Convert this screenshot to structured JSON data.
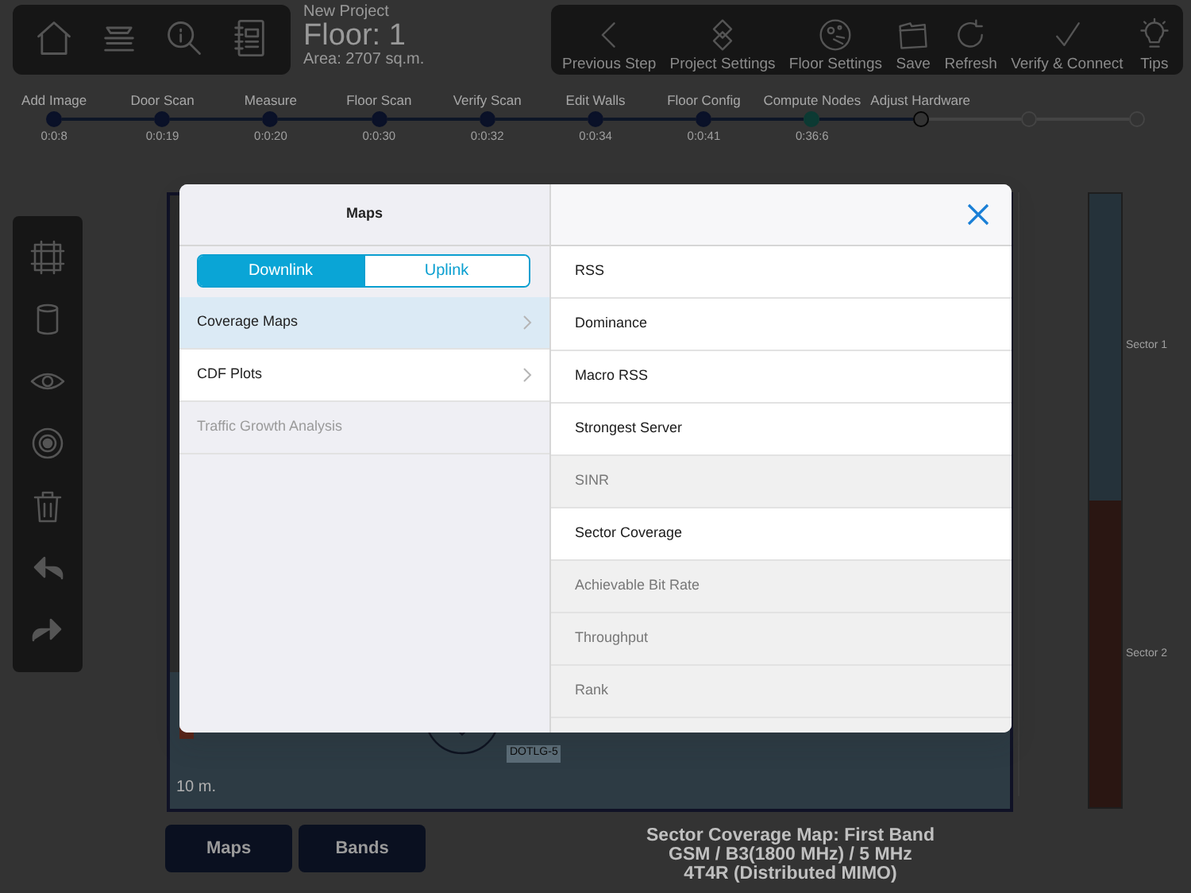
{
  "project": {
    "name": "New Project",
    "floor": "Floor: 1",
    "area": "Area: 2707 sq.m."
  },
  "toolbar": [
    {
      "label": "Previous Step"
    },
    {
      "label": "Project Settings"
    },
    {
      "label": "Floor Settings"
    },
    {
      "label": "Save"
    },
    {
      "label": "Refresh"
    },
    {
      "label": "Verify & Connect"
    },
    {
      "label": "Tips"
    }
  ],
  "steps": [
    {
      "label": "Add Image",
      "time": "0:0:8",
      "completed": true,
      "selected": false,
      "color": "#0a1128"
    },
    {
      "label": "Door Scan",
      "time": "0:0:19",
      "completed": true,
      "selected": false,
      "color": "#0a1128"
    },
    {
      "label": "Measure",
      "time": "0:0:20",
      "completed": true,
      "selected": false,
      "color": "#0a1128"
    },
    {
      "label": "Floor Scan",
      "time": "0:0:30",
      "completed": true,
      "selected": false,
      "color": "#0a1128"
    },
    {
      "label": "Verify Scan",
      "time": "0:0:32",
      "completed": true,
      "selected": false,
      "color": "#0a1128"
    },
    {
      "label": "Edit Walls",
      "time": "0:0:34",
      "completed": true,
      "selected": false,
      "color": "#0a1128"
    },
    {
      "label": "Floor Config",
      "time": "0:0:41",
      "completed": true,
      "selected": false,
      "color": "#0a1128"
    },
    {
      "label": "Compute Nodes",
      "time": "0:36:6",
      "completed": true,
      "selected": false,
      "color": "#0c3a33"
    },
    {
      "label": "Adjust Hardware",
      "completed": false,
      "selected": true
    },
    {
      "completed": false,
      "selected": false
    },
    {
      "completed": false,
      "selected": false
    }
  ],
  "floor_plan": {
    "device_label": "DOTLG-5",
    "scale": "10 m."
  },
  "legend": [
    {
      "label": "Sector 1",
      "color": "#25323a"
    },
    {
      "label": "Sector 2",
      "color": "#2a1612"
    }
  ],
  "bottom_buttons": [
    {
      "label": "Maps"
    },
    {
      "label": "Bands"
    }
  ],
  "caption": [
    "Sector Coverage Map: First Band",
    "GSM / B3(1800 MHz) / 5 MHz",
    "4T4R (Distributed MIMO)"
  ],
  "modal": {
    "title": "Maps",
    "segments": [
      {
        "label": "Downlink",
        "selected": true
      },
      {
        "label": "Uplink",
        "selected": false
      }
    ],
    "categories": [
      {
        "label": "Coverage Maps",
        "selected": true,
        "disabled": false,
        "has_submenu": true
      },
      {
        "label": "CDF Plots",
        "selected": false,
        "disabled": false,
        "has_submenu": true
      },
      {
        "label": "Traffic Growth Analysis",
        "selected": false,
        "disabled": true,
        "has_submenu": false
      }
    ],
    "items": [
      {
        "label": "RSS",
        "disabled": false
      },
      {
        "label": "Dominance",
        "disabled": false
      },
      {
        "label": "Macro RSS",
        "disabled": false
      },
      {
        "label": "Strongest Server",
        "disabled": false
      },
      {
        "label": "SINR",
        "disabled": true
      },
      {
        "label": "Sector Coverage",
        "disabled": false
      },
      {
        "label": "Achievable Bit Rate",
        "disabled": true
      },
      {
        "label": "Throughput",
        "disabled": true
      },
      {
        "label": "Rank",
        "disabled": true
      }
    ]
  }
}
